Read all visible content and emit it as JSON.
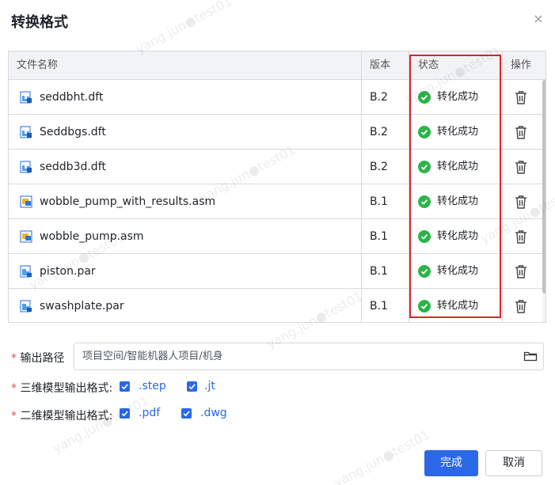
{
  "dialog": {
    "title": "转换格式",
    "close_label": "×"
  },
  "table": {
    "headers": {
      "name": "文件名称",
      "version": "版本",
      "status": "状态",
      "operation": "操作"
    },
    "rows": [
      {
        "name": "seddbht.dft",
        "version": "B.2",
        "status": "转化成功",
        "icon": "draft-file-icon"
      },
      {
        "name": "Seddbgs.dft",
        "version": "B.2",
        "status": "转化成功",
        "icon": "draft-file-icon"
      },
      {
        "name": "seddb3d.dft",
        "version": "B.2",
        "status": "转化成功",
        "icon": "draft-file-icon"
      },
      {
        "name": "wobble_pump_with_results.asm",
        "version": "B.1",
        "status": "转化成功",
        "icon": "assembly-file-icon"
      },
      {
        "name": "wobble_pump.asm",
        "version": "B.1",
        "status": "转化成功",
        "icon": "assembly-file-icon"
      },
      {
        "name": "piston.par",
        "version": "B.1",
        "status": "转化成功",
        "icon": "part-file-icon"
      },
      {
        "name": "swashplate.par",
        "version": "B.1",
        "status": "转化成功",
        "icon": "part-file-icon"
      }
    ]
  },
  "form": {
    "required_mark": "*",
    "output_path_label": "输出路径",
    "output_path_value": "项目空间/智能机器人项目/机身",
    "format3d_label": "三维模型输出格式:",
    "format3d_options": [
      {
        "label": ".step",
        "checked": true
      },
      {
        "label": ".jt",
        "checked": true
      }
    ],
    "format2d_label": "二维模型输出格式:",
    "format2d_options": [
      {
        "label": ".pdf",
        "checked": true
      },
      {
        "label": ".dwg",
        "checked": true
      }
    ]
  },
  "buttons": {
    "ok": "完成",
    "cancel": "取消"
  },
  "watermark": "yang.jun●test01",
  "colors": {
    "primary": "#2a68e8",
    "success": "#2bb44a",
    "highlight": "#d9262c",
    "required": "#e34d59"
  }
}
